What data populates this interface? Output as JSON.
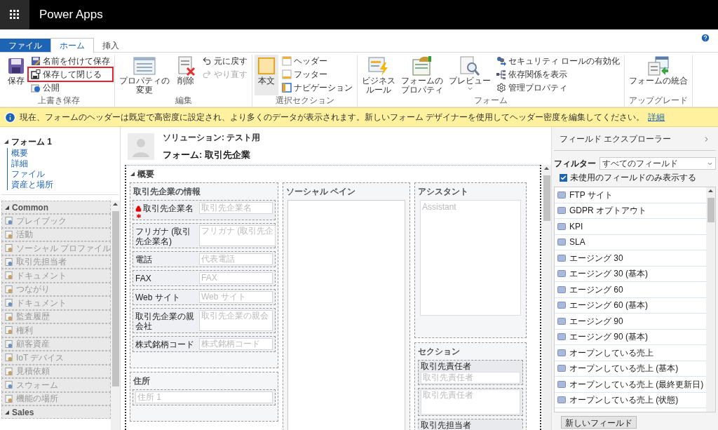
{
  "app_bar": {
    "title": "Power Apps"
  },
  "ribbon_tabs": [
    {
      "label": "ファイル",
      "kind": "file",
      "selected": false
    },
    {
      "label": "ホーム",
      "kind": "tab",
      "selected": true
    },
    {
      "label": "挿入",
      "kind": "tab",
      "selected": false
    }
  ],
  "ribbon_groups": [
    {
      "label": "上書き保存",
      "buttons": [
        {
          "label": [
            "保存"
          ],
          "kind": "large",
          "disabled": false,
          "highlighted": false,
          "selected": false
        },
        {
          "label": "名前を付けて保存",
          "kind": "small",
          "disabled": false,
          "highlighted": false,
          "selected": false
        },
        {
          "label": "保存して閉じる",
          "kind": "small",
          "disabled": false,
          "highlighted": true,
          "selected": false
        },
        {
          "label": "公開",
          "kind": "small",
          "disabled": false,
          "highlighted": false,
          "selected": false
        }
      ]
    },
    {
      "label": "編集",
      "buttons": [
        {
          "label": [
            "プロパティの",
            "変更"
          ],
          "kind": "large",
          "disabled": false,
          "highlighted": false,
          "selected": false
        },
        {
          "label": [
            "削除"
          ],
          "kind": "large",
          "disabled": false,
          "highlighted": false,
          "selected": false
        },
        {
          "label": "元に戻す",
          "kind": "small",
          "disabled": false,
          "highlighted": false,
          "selected": false
        },
        {
          "label": "やり直す",
          "kind": "small",
          "disabled": true,
          "highlighted": false,
          "selected": false
        }
      ]
    },
    {
      "label": "選択セクション",
      "buttons": [
        {
          "label": [
            "本文"
          ],
          "kind": "large",
          "disabled": false,
          "highlighted": false,
          "selected": true
        },
        {
          "label": "ヘッダー",
          "kind": "small",
          "disabled": false,
          "highlighted": false,
          "selected": false
        },
        {
          "label": "フッター",
          "kind": "small",
          "disabled": false,
          "highlighted": false,
          "selected": false
        },
        {
          "label": "ナビゲーション",
          "kind": "small",
          "disabled": false,
          "highlighted": false,
          "selected": false
        }
      ]
    },
    {
      "label": "フォーム",
      "buttons": [
        {
          "label": [
            "ビジネス",
            "ルール"
          ],
          "kind": "large",
          "disabled": false,
          "highlighted": false,
          "selected": false
        },
        {
          "label": [
            "フォームの",
            "プロパティ"
          ],
          "kind": "large",
          "disabled": false,
          "highlighted": false,
          "selected": false
        },
        {
          "label": [
            "プレビュー"
          ],
          "kind": "large",
          "dropdown": true,
          "disabled": false,
          "highlighted": false,
          "selected": false
        },
        {
          "label": "セキュリティ ロールの有効化",
          "kind": "small",
          "disabled": false,
          "highlighted": false,
          "selected": false
        },
        {
          "label": "依存関係を表示",
          "kind": "small",
          "disabled": false,
          "highlighted": false,
          "selected": false
        },
        {
          "label": "管理プロパティ",
          "kind": "small",
          "disabled": false,
          "highlighted": false,
          "selected": false
        }
      ]
    },
    {
      "label": "アップグレード",
      "buttons": [
        {
          "label": [
            "フォームの統合"
          ],
          "kind": "large",
          "disabled": false,
          "highlighted": false,
          "selected": false
        }
      ]
    }
  ],
  "info_bar": {
    "message": "現在、フォームのヘッダーは既定で高密度に設定され、より多くのデータが表示されます。新しいフォーム デザイナーを使用してヘッダー密度を編集してください。",
    "link": "詳細"
  },
  "nav_tree": {
    "label": "フォーム 1",
    "expanded": true,
    "children": [
      {
        "label": "概要"
      },
      {
        "label": "詳細"
      },
      {
        "label": "ファイル"
      },
      {
        "label": "資産と場所"
      }
    ]
  },
  "component_groups": [
    {
      "label": "Common",
      "expanded": true,
      "items": [
        "プレイブック",
        "活動",
        "ソーシャル プロファイル",
        "取引先担当者",
        "ドキュメント",
        "つながり",
        "ドキュメント",
        "監査履歴",
        "権利",
        "顧客資産",
        "IoT デバイス",
        "見積依頼",
        "スウォーム",
        "機能の場所"
      ]
    },
    {
      "label": "Sales",
      "expanded": true
    }
  ],
  "form_header": {
    "solution": "ソリューション: テスト用",
    "form": "フォーム: 取引先企業"
  },
  "form_tab": {
    "label": "概要",
    "expanded": true,
    "columns": [
      [
        {
          "label": "取引先企業の情報",
          "fields": [
            {
              "label": "取引先企業名",
              "placeholder": "取引先企業名",
              "required": true,
              "locked": true,
              "tall": false
            },
            {
              "label": "フリガナ (取引先企業名)",
              "placeholder": "フリガナ (取引先企",
              "required": false,
              "locked": false,
              "tall": true
            },
            {
              "label": "電話",
              "placeholder": "代表電話",
              "required": false,
              "locked": false,
              "tall": false
            },
            {
              "label": "FAX",
              "placeholder": "FAX",
              "required": false,
              "locked": false,
              "tall": false
            },
            {
              "label": "Web サイト",
              "placeholder": "Web サイト",
              "required": false,
              "locked": false,
              "tall": false
            },
            {
              "label": "取引先企業の親会社",
              "placeholder": "取引先企業の親会",
              "required": false,
              "locked": false,
              "tall": true
            },
            {
              "label": "株式銘柄コード",
              "placeholder": "株式銘柄コード",
              "required": false,
              "locked": false,
              "tall": false
            }
          ]
        },
        {
          "label": "住所",
          "fields": [
            {
              "placeholder": "住所 1",
              "tall": false
            }
          ]
        }
      ],
      [
        {
          "label": "ソーシャル ペイン",
          "kind": "pane"
        }
      ],
      [
        {
          "label": "アシスタント",
          "kind": "assistant",
          "placeholder": "Assistant"
        },
        {
          "label": "セクション",
          "kind": "stacked",
          "fields": [
            {
              "label": "取引先責任者",
              "placeholder": "取引先責任者",
              "tall": false
            },
            {
              "placeholder": "取引先責任者",
              "tall": true
            },
            {
              "label": "取引先担当者"
            }
          ]
        }
      ]
    ]
  },
  "field_explorer": {
    "title": "フィールド エクスプローラー",
    "filter_label": "フィルター",
    "filter_value": "すべてのフィールド",
    "unused_only": {
      "label": "未使用のフィールドのみ表示する",
      "checked": true
    },
    "fields": [
      "FTP サイト",
      "GDPR オプトアウト",
      "KPI",
      "SLA",
      "エージング 30",
      "エージング 30 (基本)",
      "エージング 60",
      "エージング 60 (基本)",
      "エージング 90",
      "エージング 90 (基本)",
      "オープンしている売上",
      "オープンしている売上 (基本)",
      "オープンしている売上 (最終更新日)",
      "オープンしている売上 (状態)"
    ],
    "new_field_button": "新しいフィールド"
  }
}
